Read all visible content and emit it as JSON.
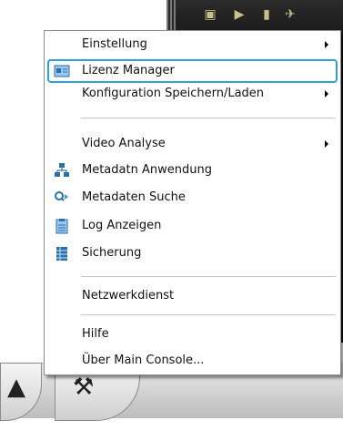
{
  "menu": {
    "items": [
      {
        "label": "Einstellung",
        "submenu": true,
        "icon": null
      },
      {
        "label": "Lizenz Manager",
        "submenu": false,
        "icon": "license-card-icon",
        "highlighted": true
      },
      {
        "label": "Konfiguration Speichern/Laden",
        "submenu": true,
        "icon": null
      },
      {
        "label": "Video Analyse",
        "submenu": true,
        "icon": null
      },
      {
        "label": "Metadatn Anwendung",
        "submenu": false,
        "icon": "network-tree-icon"
      },
      {
        "label": "Metadaten Suche",
        "submenu": false,
        "icon": "search-arrow-icon"
      },
      {
        "label": "Log Anzeigen",
        "submenu": false,
        "icon": "clipboard-log-icon"
      },
      {
        "label": "Sicherung",
        "submenu": false,
        "icon": "backup-table-icon"
      },
      {
        "label": "Netzwerkdienst",
        "submenu": false,
        "icon": null
      },
      {
        "label": "Hilfe",
        "submenu": false,
        "icon": null
      },
      {
        "label": "Über Main Console...",
        "submenu": false,
        "icon": null
      }
    ]
  },
  "colors": {
    "highlight_border": "#2e9fdc",
    "icon_blue": "#2a6fb0",
    "background_dark": "#111111"
  }
}
